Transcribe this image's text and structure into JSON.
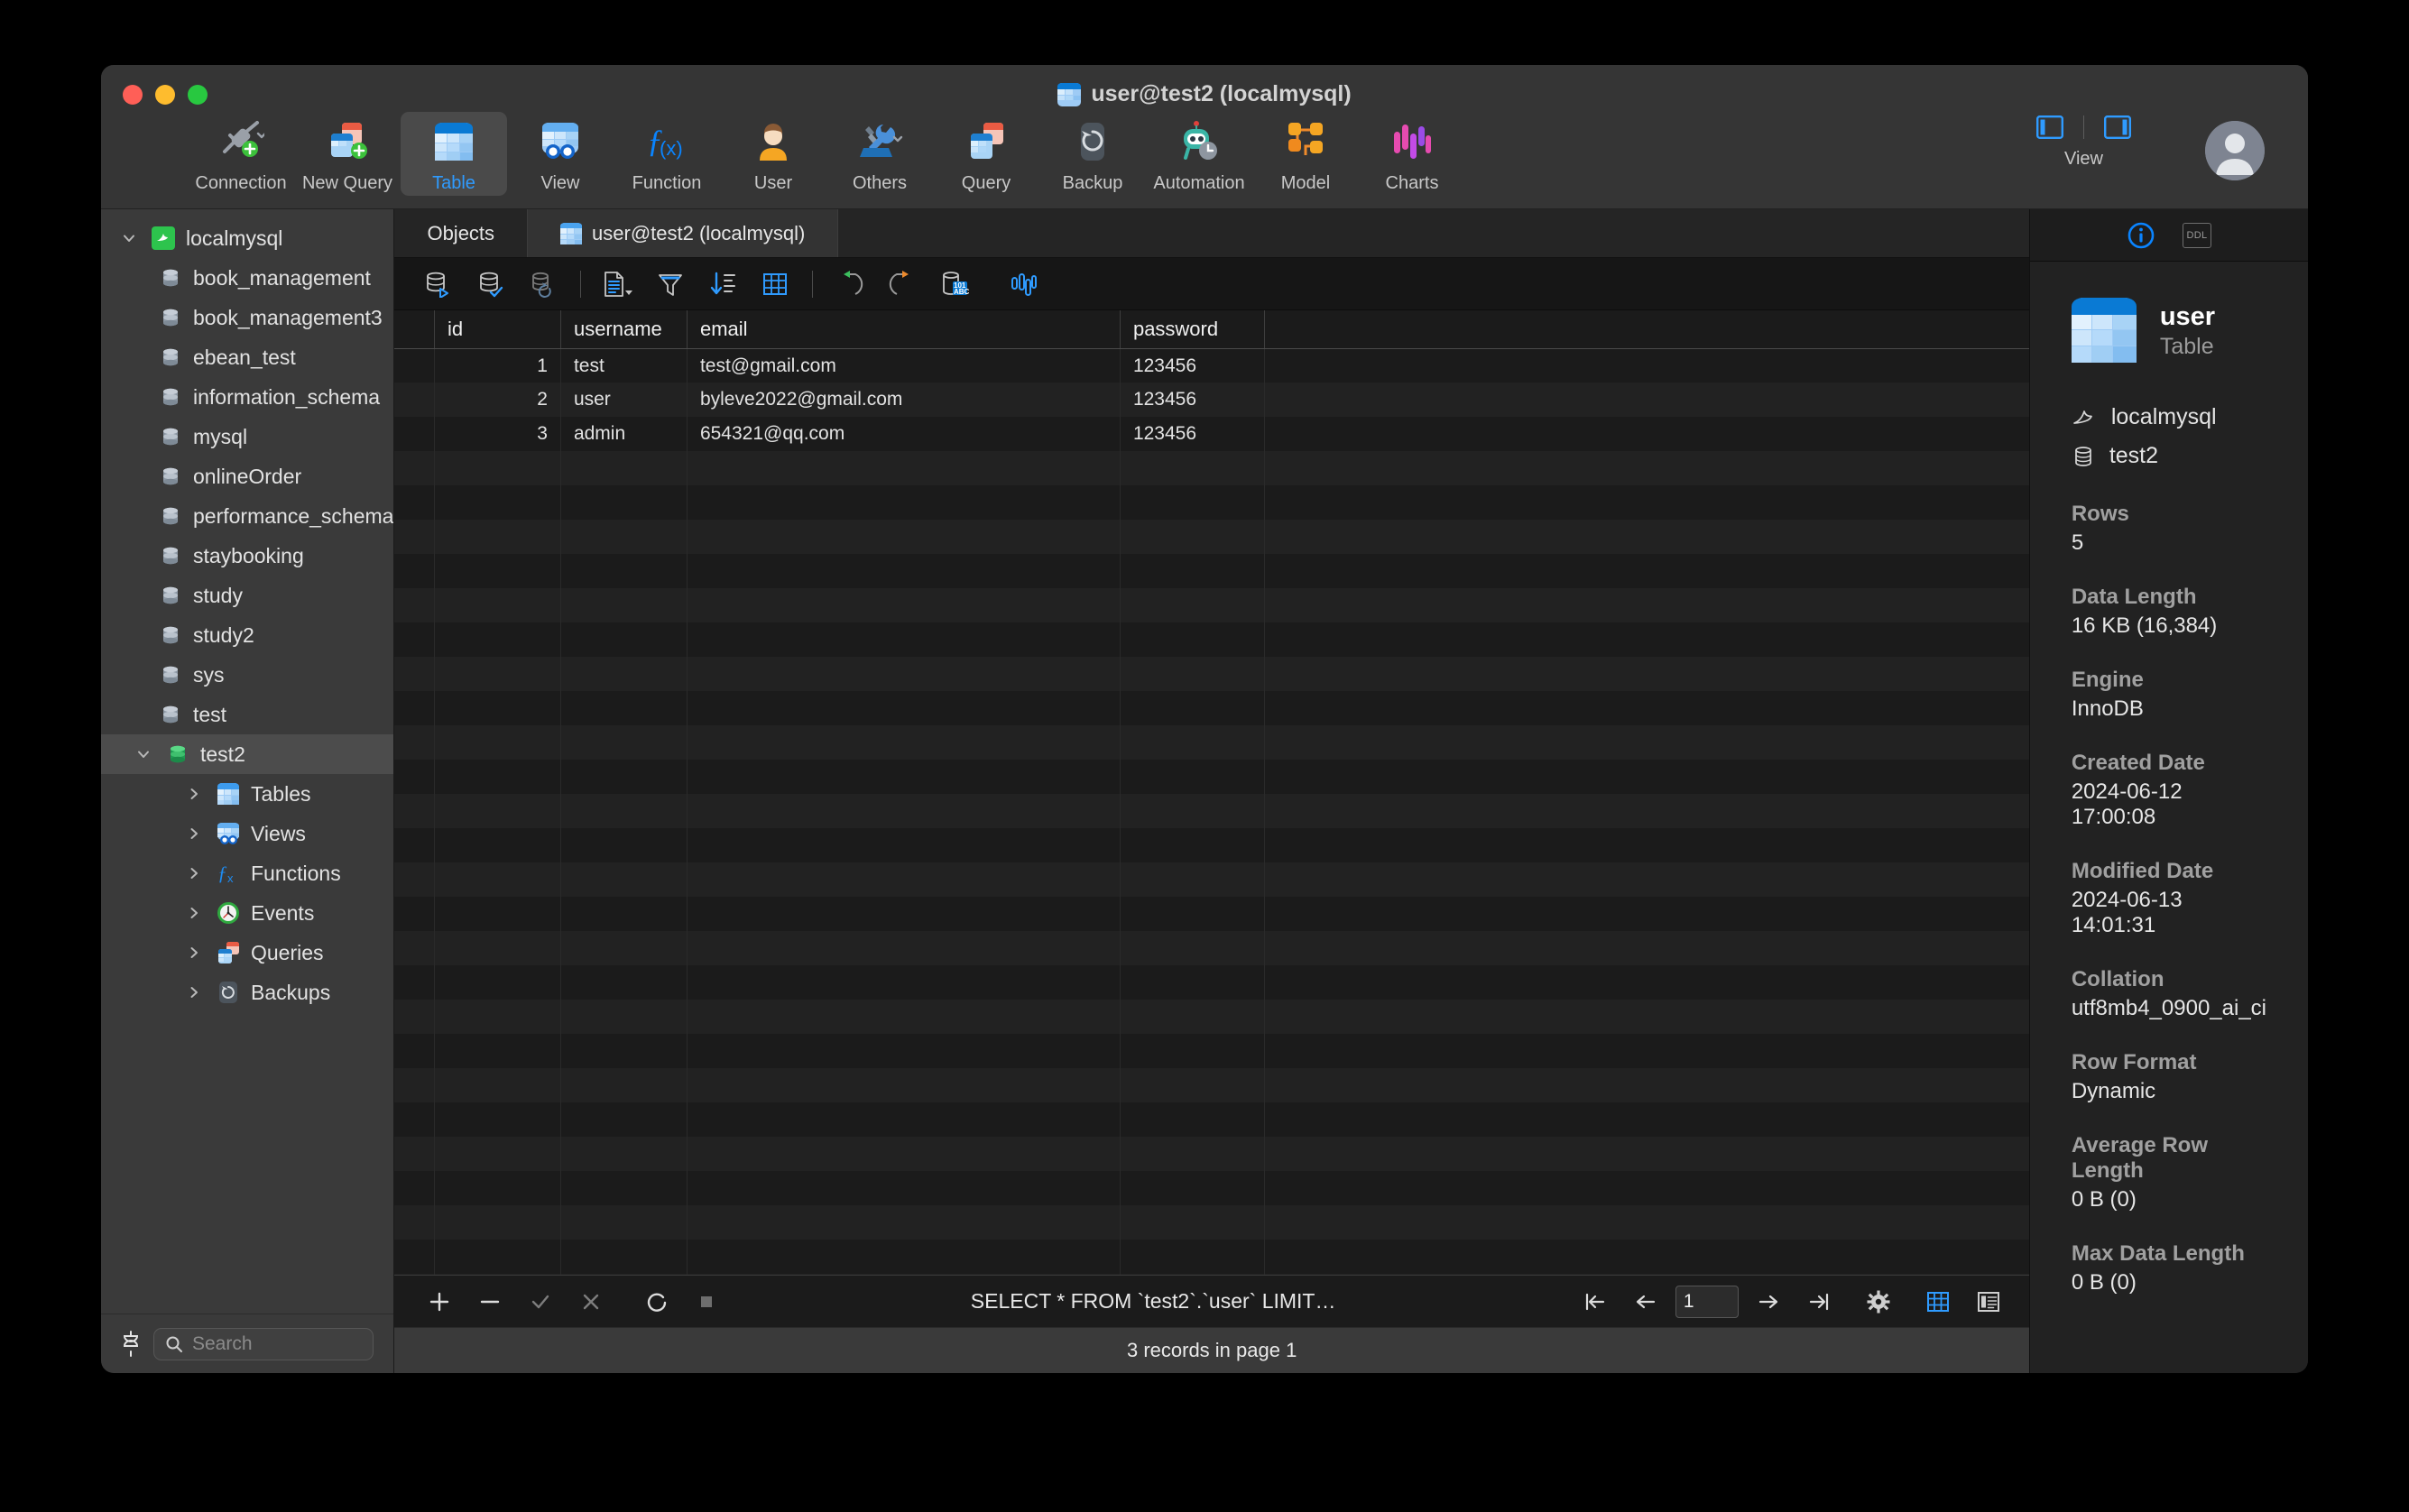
{
  "window": {
    "title": "user@test2 (localmysql)",
    "title_icon": "table-icon",
    "traffic_lights": [
      "close-button",
      "minimize-button",
      "zoom-button"
    ]
  },
  "toolbar": {
    "items": [
      {
        "label": "Connection",
        "icon": "connection-icon",
        "active": false
      },
      {
        "label": "New Query",
        "icon": "new-query-icon",
        "active": false
      },
      {
        "label": "Table",
        "icon": "table-icon",
        "active": true
      },
      {
        "label": "View",
        "icon": "view-icon",
        "active": false
      },
      {
        "label": "Function",
        "icon": "function-icon",
        "active": false
      },
      {
        "label": "User",
        "icon": "user-icon",
        "active": false
      },
      {
        "label": "Others",
        "icon": "others-icon",
        "active": false
      },
      {
        "label": "Query",
        "icon": "query-icon",
        "active": false
      },
      {
        "label": "Backup",
        "icon": "backup-icon",
        "active": false
      },
      {
        "label": "Automation",
        "icon": "automation-icon",
        "active": false
      },
      {
        "label": "Model",
        "icon": "model-icon",
        "active": false
      },
      {
        "label": "Charts",
        "icon": "charts-icon",
        "active": false
      }
    ],
    "view_label": "View",
    "view_left_icon": "sidebar-left-toggle-icon",
    "view_right_icon": "sidebar-right-toggle-icon",
    "avatar_icon": "avatar-icon"
  },
  "sidebar": {
    "connection": {
      "label": "localmysql",
      "icon": "mysql-dolphin-icon",
      "expanded": true
    },
    "databases": [
      {
        "label": "book_management",
        "icon": "database-icon"
      },
      {
        "label": "book_management3",
        "icon": "database-icon"
      },
      {
        "label": "ebean_test",
        "icon": "database-icon"
      },
      {
        "label": "information_schema",
        "icon": "database-icon"
      },
      {
        "label": "mysql",
        "icon": "database-icon"
      },
      {
        "label": "onlineOrder",
        "icon": "database-icon"
      },
      {
        "label": "performance_schema",
        "icon": "database-icon"
      },
      {
        "label": "staybooking",
        "icon": "database-icon"
      },
      {
        "label": "study",
        "icon": "database-icon"
      },
      {
        "label": "study2",
        "icon": "database-icon"
      },
      {
        "label": "sys",
        "icon": "database-icon"
      },
      {
        "label": "test",
        "icon": "database-icon"
      }
    ],
    "selected_database": {
      "label": "test2",
      "icon": "database-open-icon",
      "expanded": true
    },
    "children": [
      {
        "label": "Tables",
        "icon": "tables-icon"
      },
      {
        "label": "Views",
        "icon": "views-icon"
      },
      {
        "label": "Functions",
        "icon": "functions-icon"
      },
      {
        "label": "Events",
        "icon": "events-icon"
      },
      {
        "label": "Queries",
        "icon": "queries-icon"
      },
      {
        "label": "Backups",
        "icon": "backups-icon"
      }
    ],
    "bottom": {
      "connect_icon": "connection-status-icon",
      "search_placeholder": "Search",
      "search_value": ""
    }
  },
  "tabs": [
    {
      "label": "Objects",
      "icon": null,
      "active": false
    },
    {
      "label": "user@test2 (localmysql)",
      "icon": "table-icon",
      "active": true
    }
  ],
  "grid_toolbar": {
    "buttons": [
      {
        "name": "begin-transaction-icon"
      },
      {
        "name": "commit-icon"
      },
      {
        "name": "rollback-icon"
      },
      {
        "name": "import-wizard-icon"
      },
      {
        "name": "filter-icon"
      },
      {
        "name": "sort-icon"
      },
      {
        "name": "grid-view-icon"
      },
      {
        "name": "undo-icon"
      },
      {
        "name": "redo-icon"
      },
      {
        "name": "hex-view-icon"
      },
      {
        "name": "chart-view-icon"
      }
    ]
  },
  "grid": {
    "columns": [
      "id",
      "username",
      "email",
      "password"
    ],
    "rows": [
      {
        "id": "1",
        "username": "test",
        "email": "test@gmail.com",
        "password": "123456"
      },
      {
        "id": "2",
        "username": "user",
        "email": "byleve2022@gmail.com",
        "password": "123456"
      },
      {
        "id": "3",
        "username": "admin",
        "email": "654321@qq.com",
        "password": "123456"
      }
    ],
    "empty_row_count": 26
  },
  "action_bar": {
    "add_icon": "plus-icon",
    "remove_icon": "minus-icon",
    "apply_icon": "check-icon",
    "cancel_icon": "cross-icon",
    "refresh_icon": "refresh-icon",
    "stop_icon": "stop-icon",
    "sql_text": "SELECT * FROM `test2`.`user` LIMIT…",
    "pager": {
      "first_icon": "page-first-icon",
      "prev_icon": "page-prev-icon",
      "page_value": "1",
      "next_icon": "page-next-icon",
      "last_icon": "page-last-icon",
      "settings_icon": "gear-icon",
      "grid_mode_icon": "grid-mode-icon",
      "form_mode_icon": "form-mode-icon"
    }
  },
  "status_bar": {
    "text": "3 records in page 1"
  },
  "info_panel": {
    "tabs": [
      {
        "name": "info-tab",
        "icon": "info-icon",
        "active": true
      },
      {
        "name": "ddl-tab",
        "icon": "ddl-icon",
        "label": "DDL",
        "active": false
      }
    ],
    "object": {
      "name": "user",
      "type": "Table",
      "icon": "table-icon"
    },
    "breadcrumb": [
      {
        "label": "localmysql",
        "icon": "mysql-dolphin-icon"
      },
      {
        "label": "test2",
        "icon": "database-icon"
      }
    ],
    "properties": [
      {
        "label": "Rows",
        "value": "5"
      },
      {
        "label": "Data Length",
        "value": "16 KB (16,384)"
      },
      {
        "label": "Engine",
        "value": "InnoDB"
      },
      {
        "label": "Created Date",
        "value": "2024-06-12 17:00:08"
      },
      {
        "label": "Modified Date",
        "value": "2024-06-13 14:01:31"
      },
      {
        "label": "Collation",
        "value": "utf8mb4_0900_ai_ci"
      },
      {
        "label": "Row Format",
        "value": "Dynamic"
      },
      {
        "label": "Average Row Length",
        "value": "0 B (0)"
      },
      {
        "label": "Max Data Length",
        "value": "0 B (0)"
      }
    ]
  },
  "colors": {
    "accent": "#2f9bff",
    "window_bg": "#1e1e1e",
    "toolbar_bg": "#353535",
    "sidebar_bg": "#3a3a3a",
    "grid_bg": "#1b1b1b",
    "panel_bg": "#222222"
  }
}
